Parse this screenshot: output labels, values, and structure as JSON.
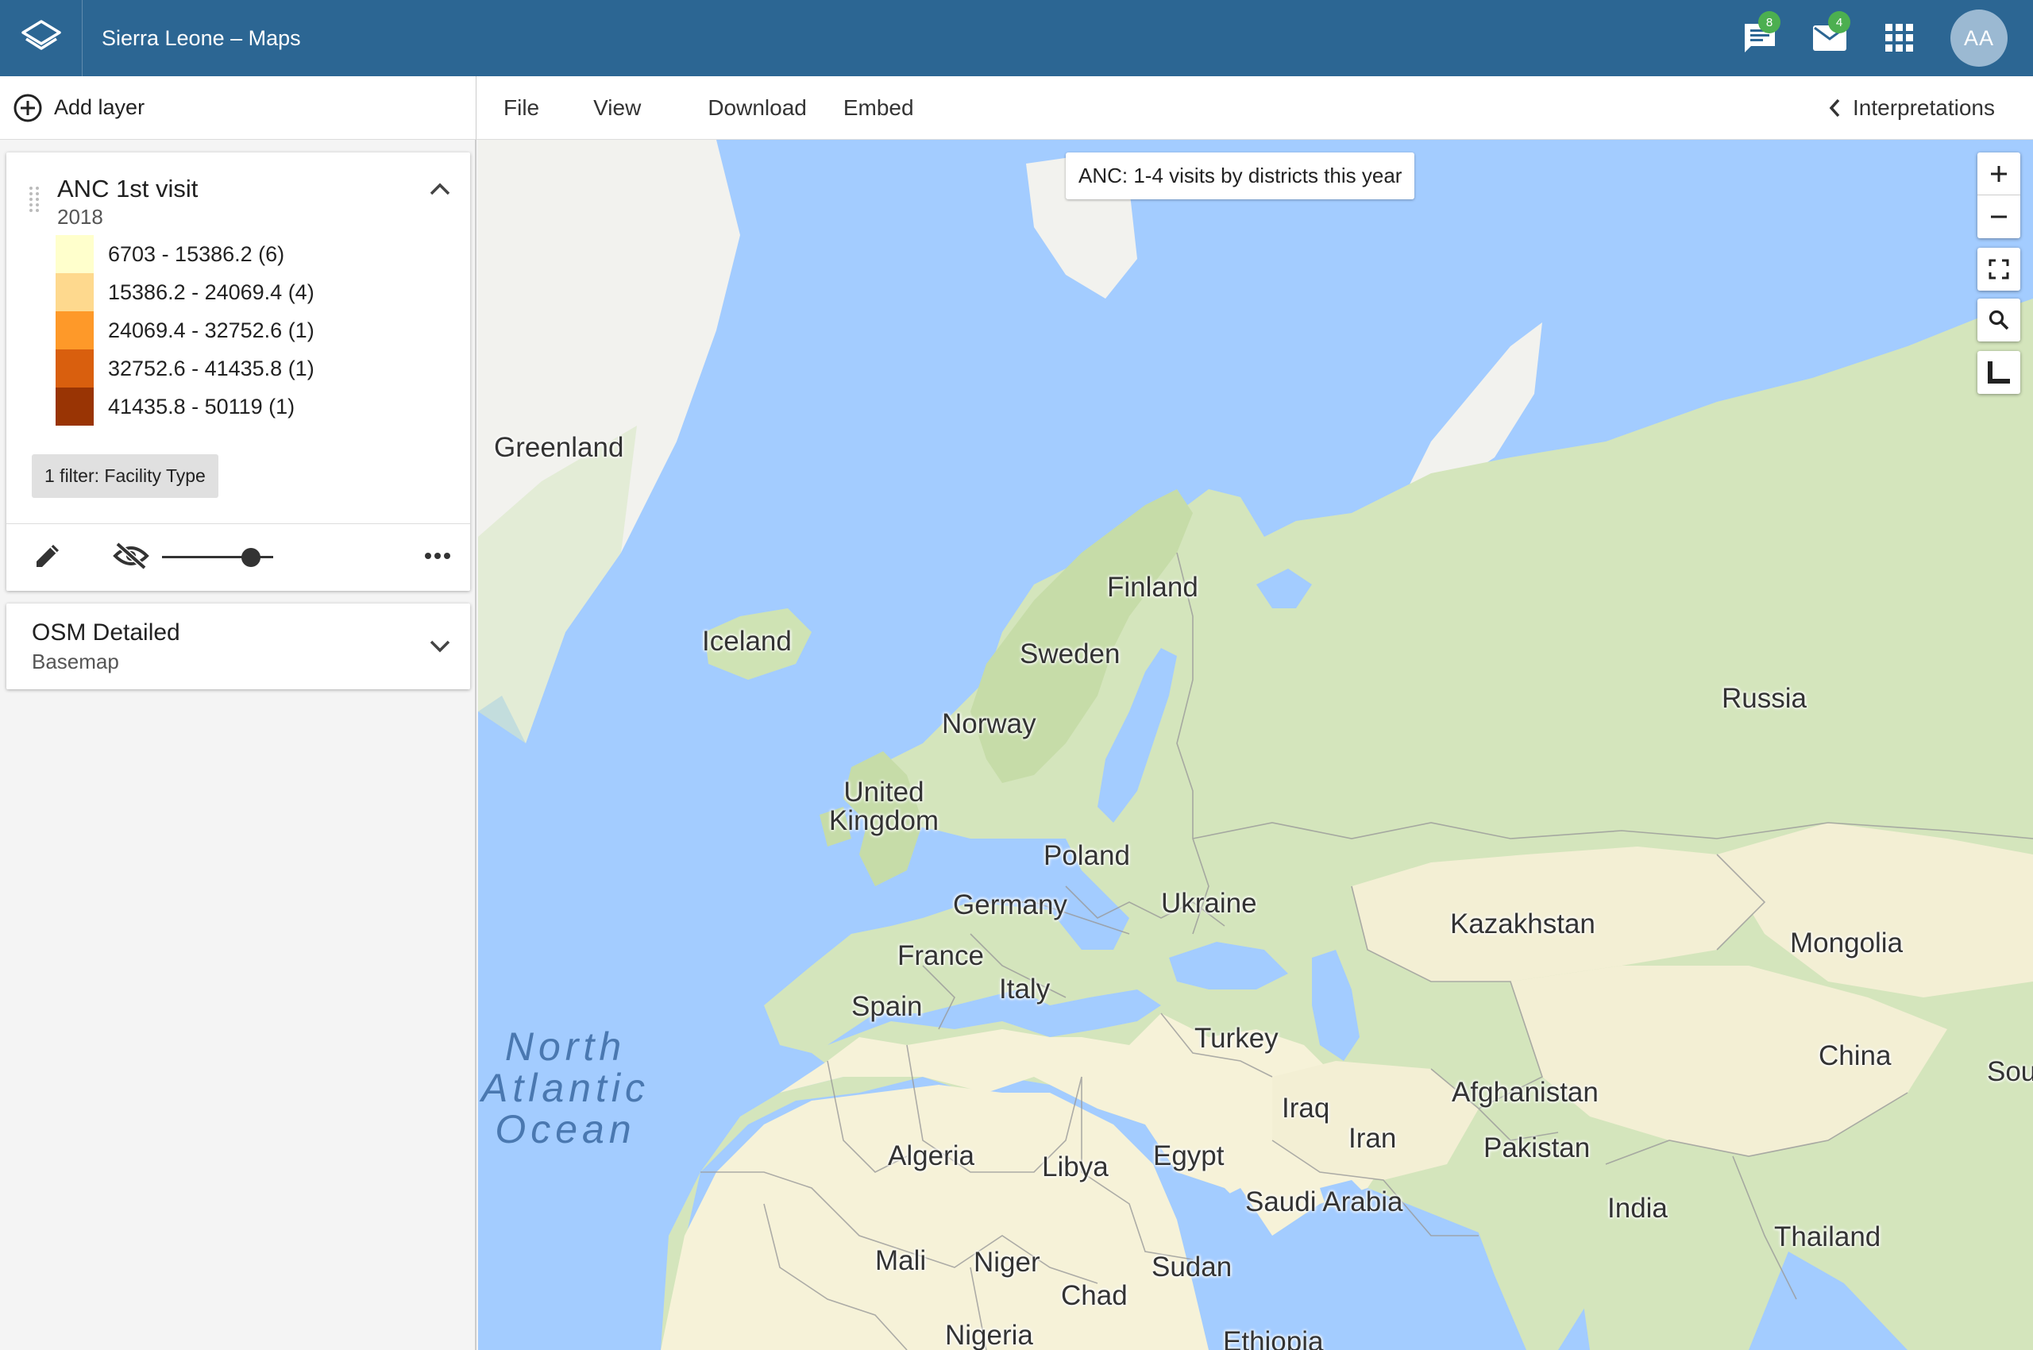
{
  "header": {
    "title": "Sierra Leone – Maps",
    "messages_badge": "8",
    "mail_badge": "4",
    "avatar_initials": "AA"
  },
  "toolbar": {
    "add_layer": "Add layer",
    "menu": [
      "File",
      "View",
      "Download",
      "Embed"
    ],
    "interpretations": "Interpretations"
  },
  "layers": [
    {
      "name": "ANC 1st visit",
      "period": "2018",
      "legend": [
        {
          "label": "6703 - 15386.2 (6)",
          "color": "#ffffcc"
        },
        {
          "label": "15386.2 - 24069.4 (4)",
          "color": "#fed98e"
        },
        {
          "label": "24069.4 - 32752.6 (1)",
          "color": "#fe9929"
        },
        {
          "label": "32752.6 - 41435.8 (1)",
          "color": "#d95f0e"
        },
        {
          "label": "41435.8 - 50119 (1)",
          "color": "#993404"
        }
      ],
      "filter": "1 filter: Facility Type",
      "opacity": 0.8
    },
    {
      "name": "OSM Detailed",
      "type": "Basemap"
    }
  ],
  "map": {
    "title": "ANC: 1-4 visits by districts this year",
    "labels": [
      "Greenland",
      "Iceland",
      "Finland",
      "Sweden",
      "Norway",
      "United Kingdom",
      "Russia",
      "Poland",
      "Germany",
      "Ukraine",
      "France",
      "Kazakhstan",
      "Mongolia",
      "Italy",
      "Spain",
      "Turkey",
      "China",
      "Sou",
      "Iraq",
      "Afghanistan",
      "Iran",
      "Pakistan",
      "Algeria",
      "Libya",
      "Egypt",
      "Saudi Arabia",
      "India",
      "Thailand",
      "Mali",
      "Niger",
      "Sudan",
      "Chad",
      "Nigeria",
      "Ethiopia"
    ],
    "ocean": [
      "North",
      "Atlantic",
      "Ocean"
    ]
  }
}
